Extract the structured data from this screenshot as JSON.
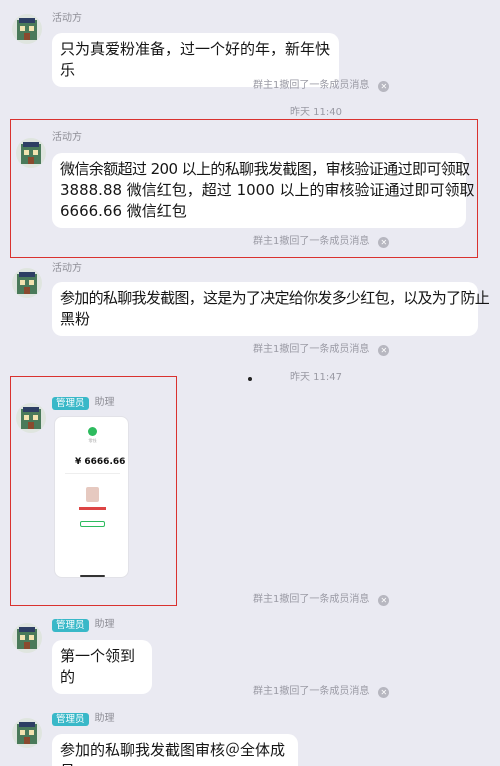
{
  "messages": [
    {
      "sender": "活动方",
      "text": "只为真爱粉准备，过一个好的年，新年快乐"
    },
    {
      "sender": "活动方",
      "lines": [
        "微信余额超过 200 以上的私聊我发截图，审核验证通过即可领取",
        "3888.88 微信红包，超过 1000 以上的审核验证通过即可领取",
        "6666.66 微信红包"
      ]
    },
    {
      "sender": "活动方",
      "lines": [
        "参加的私聊我发截图，这是为了决定给你发多少红包，以及为了防止",
        "黑粉"
      ]
    },
    {
      "role": "管理员",
      "sender": "助理",
      "screenshot": {
        "amount": "¥ 6666.66",
        "caption": "零钱",
        "button": ""
      }
    },
    {
      "role": "管理员",
      "sender": "助理",
      "text": "第一个领到的"
    },
    {
      "role": "管理员",
      "sender": "助理",
      "text": "参加的私聊我发截图审核＠全体成员"
    }
  ],
  "recall_notice": "群主1撤回了一条成员消息",
  "timestamps": [
    "昨天 11:40",
    "昨天 11:47"
  ],
  "colors": {
    "background": "#eaeaf2",
    "bubble": "#ffffff",
    "highlight": "#d9322f",
    "badge": "#39b8c8"
  },
  "icons": [
    "avatar-icon",
    "close-icon",
    "wechat-pay-icon"
  ]
}
